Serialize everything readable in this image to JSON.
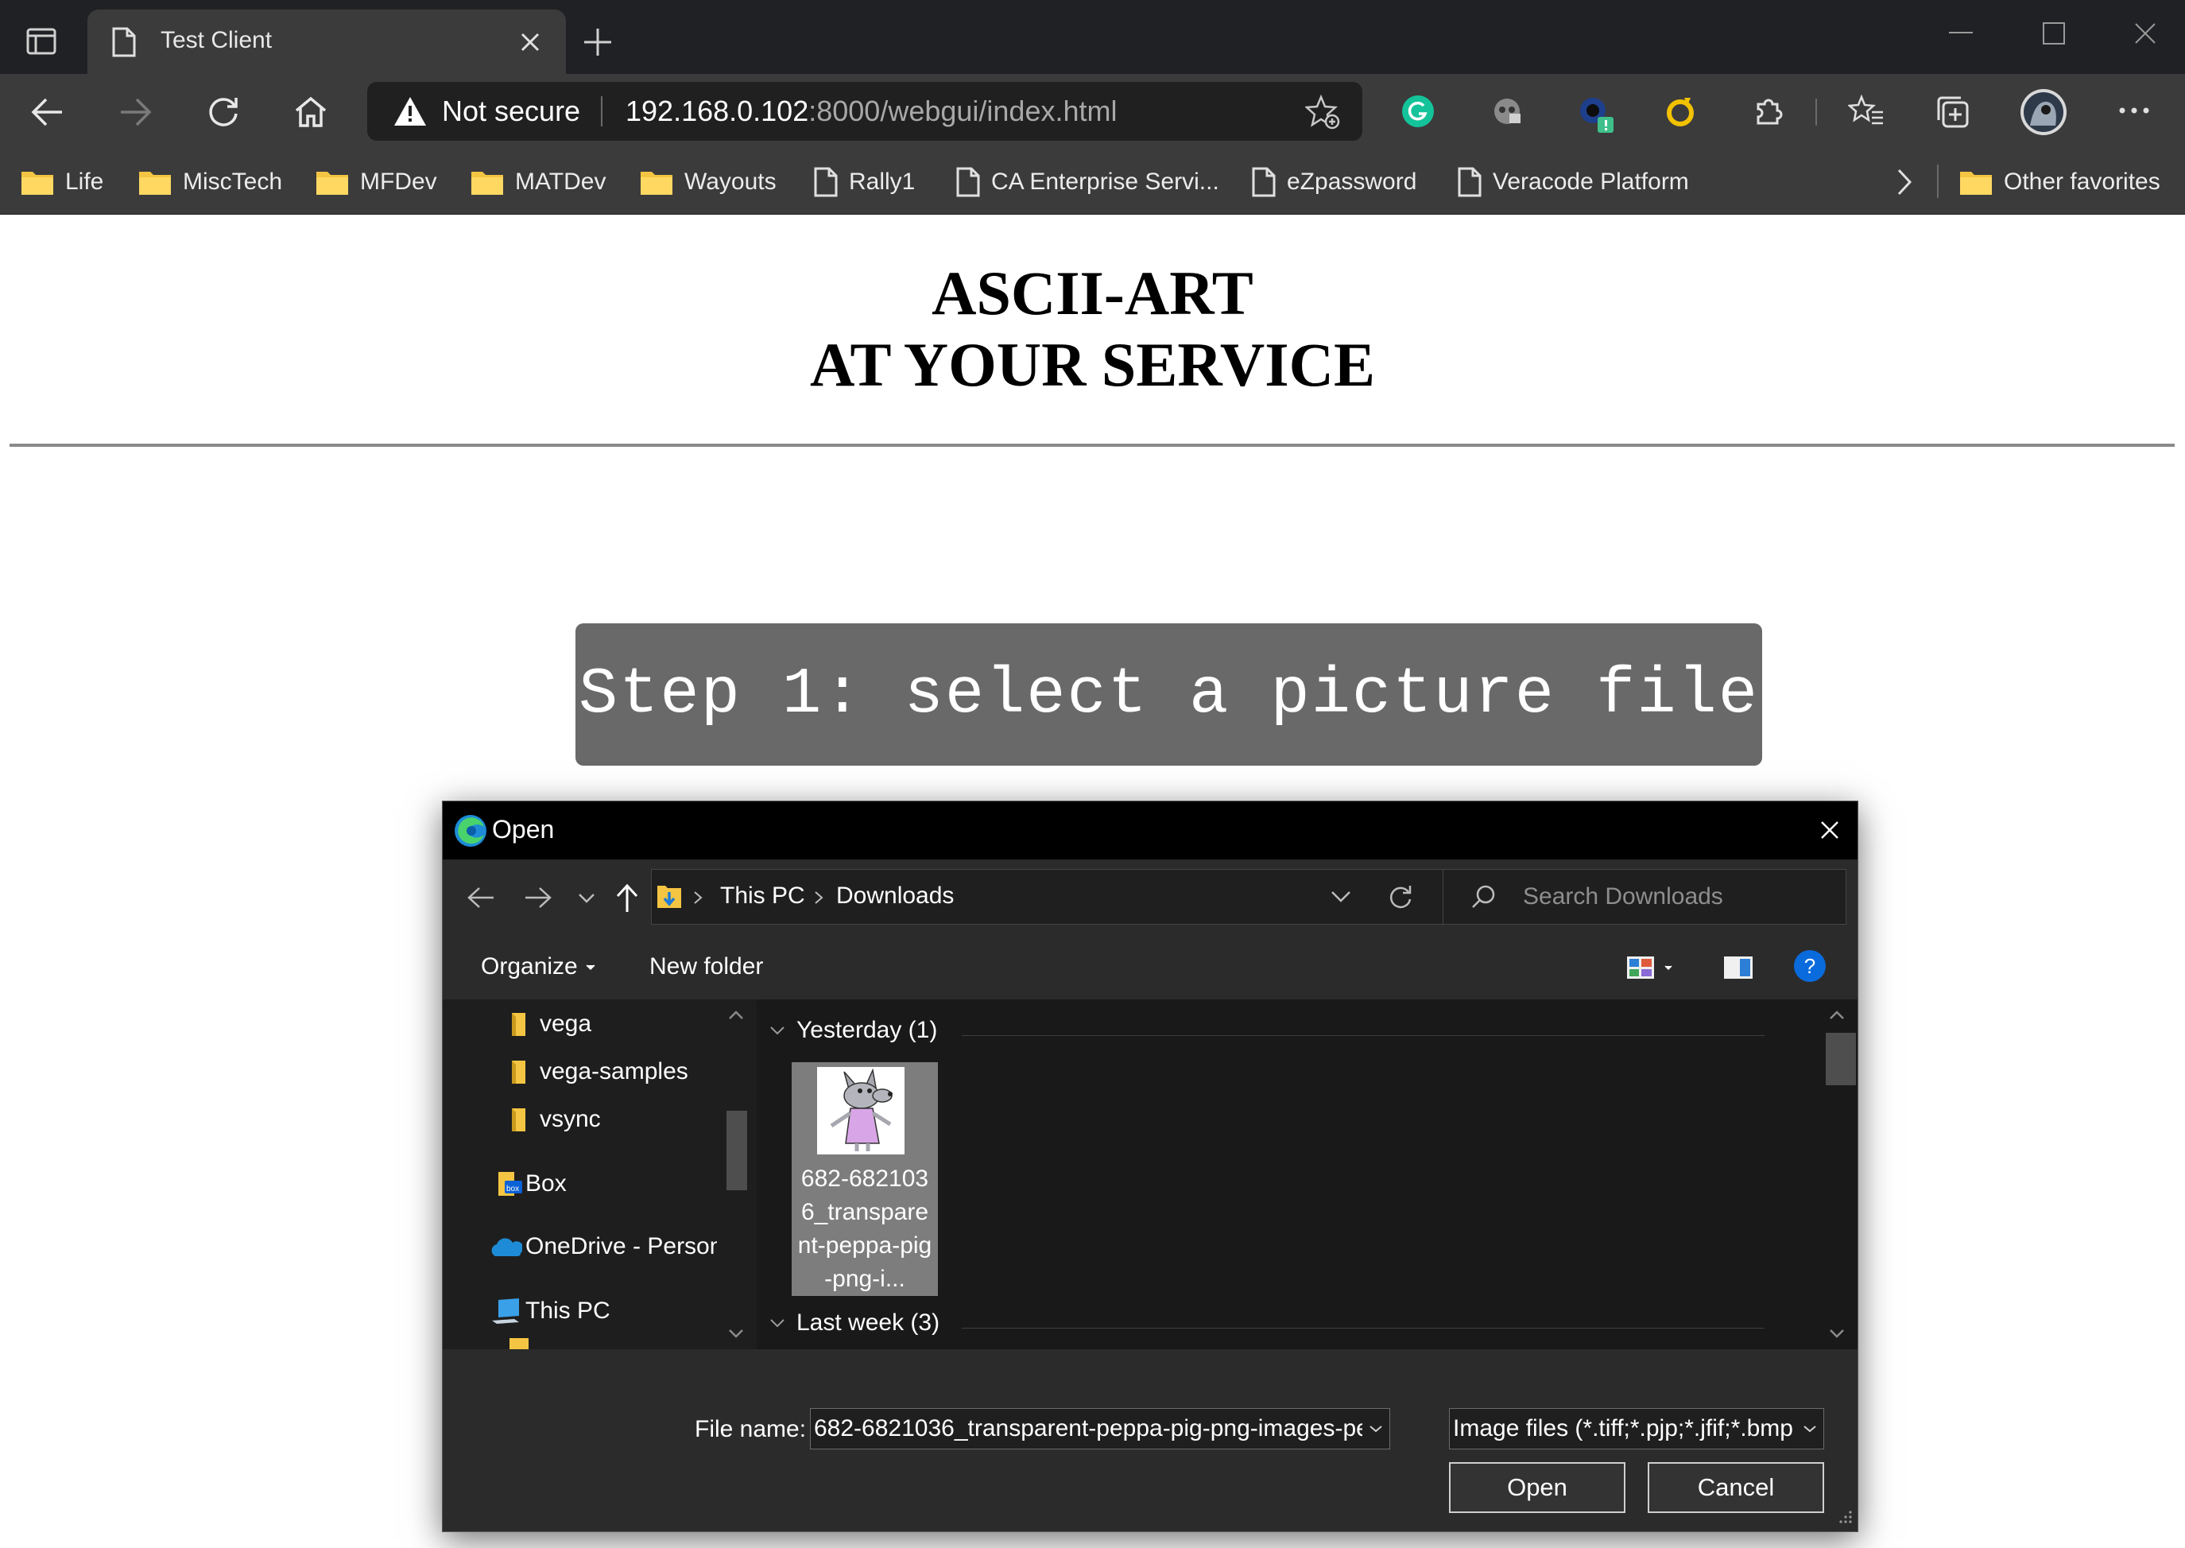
{
  "browser": {
    "tab_title": "Test Client",
    "address": {
      "security_label": "Not secure",
      "host": "192.168.0.102",
      "path": ":8000/webgui/index.html"
    },
    "favorites": [
      {
        "label": "Life",
        "icon": "folder-icon"
      },
      {
        "label": "MiscTech",
        "icon": "folder-icon"
      },
      {
        "label": "MFDev",
        "icon": "folder-icon"
      },
      {
        "label": "MATDev",
        "icon": "folder-icon"
      },
      {
        "label": "Wayouts",
        "icon": "folder-icon"
      },
      {
        "label": "Rally1",
        "icon": "page-icon"
      },
      {
        "label": "CA Enterprise Servi...",
        "icon": "page-icon"
      },
      {
        "label": "eZpassword",
        "icon": "page-icon"
      },
      {
        "label": "Veracode Platform",
        "icon": "page-icon"
      }
    ],
    "other_favorites": "Other favorites"
  },
  "page": {
    "title_line1": "ASCII-ART",
    "title_line2": "AT YOUR SERVICE",
    "step_label": "Step 1: select a picture file"
  },
  "dialog": {
    "title": "Open",
    "breadcrumb": [
      "This PC",
      "Downloads"
    ],
    "search_placeholder": "Search Downloads",
    "organize_label": "Organize",
    "new_folder_label": "New folder",
    "help_glyph": "?",
    "nav_items": [
      {
        "label": "vega",
        "icon": "folder-icon"
      },
      {
        "label": "vega-samples",
        "icon": "folder-icon"
      },
      {
        "label": "vsync",
        "icon": "folder-icon"
      },
      {
        "label": "Box",
        "icon": "box-icon"
      },
      {
        "label": "OneDrive - Person",
        "icon": "onedrive-icon"
      },
      {
        "label": "This PC",
        "icon": "computer-icon"
      }
    ],
    "groups": [
      {
        "label": "Yesterday (1)"
      },
      {
        "label": "Last week (3)"
      }
    ],
    "file_item": {
      "label": "682-6821036_transparent-peppa-pig-png-i..."
    },
    "file_name_label": "File name:",
    "file_name_value": "682-6821036_transparent-peppa-pig-png-images-pep",
    "file_type_value": "Image files (*.tiff;*.pjp;*.jfif;*.bmp",
    "open_button": "Open",
    "cancel_button": "Cancel"
  },
  "colors": {
    "chrome_dark": "#202124",
    "chrome_toolbar": "#3b3b3b",
    "step_box": "#696969",
    "folder_yellow": "#f4c542",
    "help_blue": "#0a6bdc"
  }
}
